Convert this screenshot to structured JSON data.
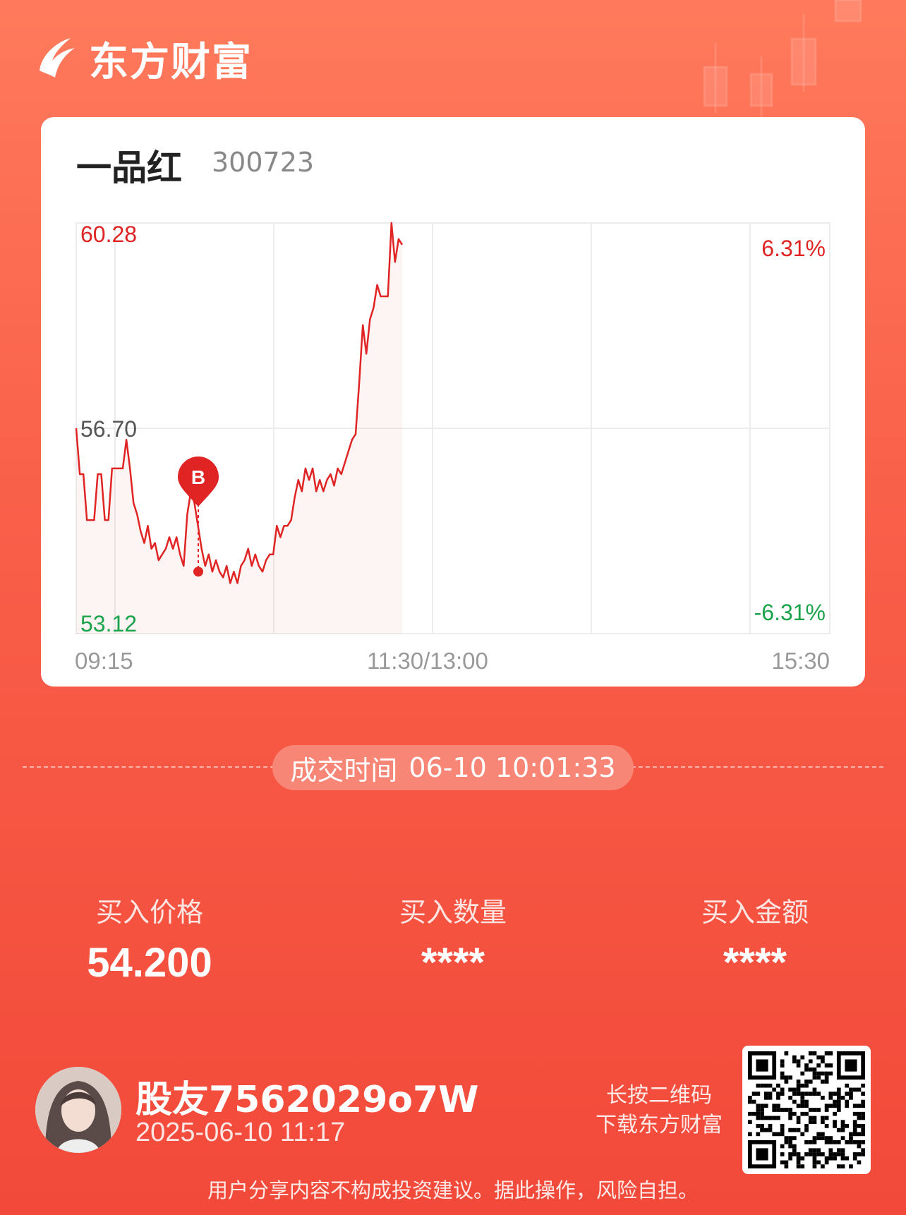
{
  "app": {
    "brand": "东方财富"
  },
  "stock": {
    "name": "一品红",
    "code": "300723"
  },
  "chart_data": {
    "type": "line",
    "y_axis": {
      "max_label": "60.28",
      "mid_label": "56.70",
      "min_label": "53.12",
      "ylim": [
        53.12,
        60.28
      ]
    },
    "pct_axis": {
      "max_label": "6.31%",
      "min_label": "-6.31%"
    },
    "x_ticks": [
      "09:15",
      "11:30/13:00",
      "15:30"
    ],
    "buy_marker": {
      "label": "B",
      "time": "10:01:33",
      "price": 54.2
    },
    "series": [
      {
        "values": [
          56.7,
          55.9,
          55.9,
          55.1,
          55.1,
          55.1,
          55.9,
          55.9,
          55.1,
          55.1,
          56.0,
          56.0,
          56.0,
          56.0,
          56.5,
          56.0,
          55.4,
          55.2,
          54.9,
          54.7,
          55.0,
          54.6,
          54.7,
          54.4,
          54.5,
          54.6,
          54.8,
          54.6,
          54.8,
          54.5,
          54.3,
          55.2,
          55.6,
          55.4,
          55.0,
          54.6,
          54.3,
          54.5,
          54.2,
          54.4,
          54.2,
          54.1,
          54.3,
          54.0,
          54.2,
          54.0,
          54.3,
          54.4,
          54.6,
          54.3,
          54.5,
          54.3,
          54.2,
          54.4,
          54.5,
          54.5,
          55.0,
          54.8,
          55.0,
          55.0,
          55.1,
          55.5,
          55.8,
          55.6,
          56.0,
          55.8,
          56.0,
          55.6,
          55.8,
          55.6,
          55.8,
          55.9,
          55.7,
          56.0,
          55.9,
          56.1,
          56.3,
          56.5,
          56.6,
          57.5,
          58.5,
          58.0,
          58.6,
          58.8,
          59.2,
          59.0,
          59.0,
          59.0,
          60.28,
          59.6,
          60.0,
          59.9
        ]
      }
    ]
  },
  "trade": {
    "label": "成交时间",
    "time": "06-10 10:01:33"
  },
  "stats": [
    {
      "label": "买入价格",
      "value": "54.200"
    },
    {
      "label": "买入数量",
      "value": "****"
    },
    {
      "label": "买入金额",
      "value": "****"
    }
  ],
  "user": {
    "name": "股友7562029o7W",
    "time": "2025-06-10 11:17"
  },
  "qr": {
    "hint_line1": "长按二维码",
    "hint_line2": "下载东方财富"
  },
  "disclaimer": "用户分享内容不构成投资建议。据此操作，风险自担。",
  "colors": {
    "accent": "#f2493a",
    "up": "#e02424",
    "down": "#1aa34a"
  }
}
